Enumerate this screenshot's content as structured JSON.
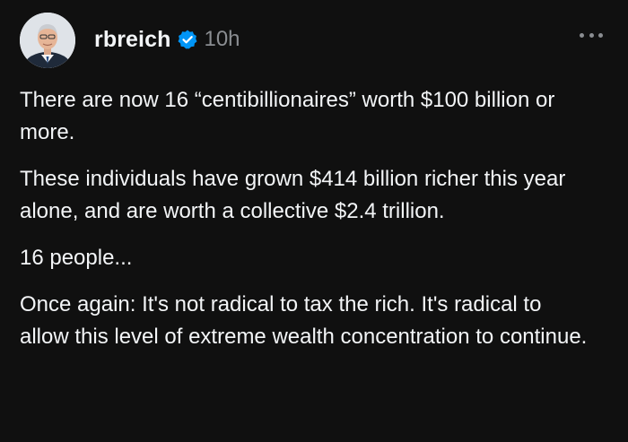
{
  "post": {
    "username": "rbreich",
    "timestamp": "10h",
    "verified_icon": "verified-badge-icon",
    "more_icon": "more-options-icon",
    "avatar_icon": "profile-avatar",
    "paragraphs": [
      "There are now 16 “centibillionaires” worth $100 billion or more.",
      "These individuals have grown $414 billion richer this year alone, and are worth a collective $2.4 trillion.",
      "16 people...",
      "Once again: It's not radical to tax the rich. It's radical to allow this level of extreme wealth concentration to continue."
    ]
  },
  "colors": {
    "background": "#101010",
    "text": "#f3f5f7",
    "secondary": "#8a8d91",
    "verified": "#0095f6"
  }
}
